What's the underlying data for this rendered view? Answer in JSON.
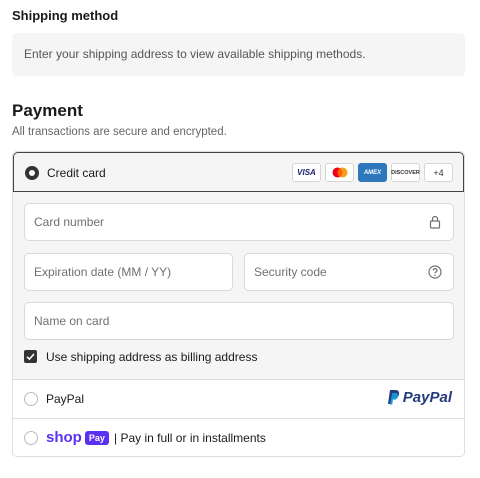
{
  "shipping": {
    "title": "Shipping method",
    "notice": "Enter your shipping address to view available shipping methods."
  },
  "payment": {
    "title": "Payment",
    "subtitle": "All transactions are secure and encrypted.",
    "credit_card": {
      "label": "Credit card",
      "selected": true,
      "card_brands": [
        "VISA",
        "mastercard",
        "AMEX",
        "DISCOVER",
        "+4"
      ],
      "fields": {
        "card_number_placeholder": "Card number",
        "expiration_placeholder": "Expiration date (MM / YY)",
        "security_code_placeholder": "Security code",
        "name_placeholder": "Name on card"
      },
      "billing_checkbox_label": "Use shipping address as billing address",
      "billing_checked": true
    },
    "paypal": {
      "label": "PayPal",
      "logo_text": "PayPal"
    },
    "shop_pay": {
      "logo_shop": "shop",
      "logo_pay": "Pay",
      "label": "| Pay in full or in installments"
    }
  },
  "colors": {
    "shop_purple": "#5a31f4",
    "paypal_dark": "#253b80",
    "paypal_light": "#179bd7"
  }
}
